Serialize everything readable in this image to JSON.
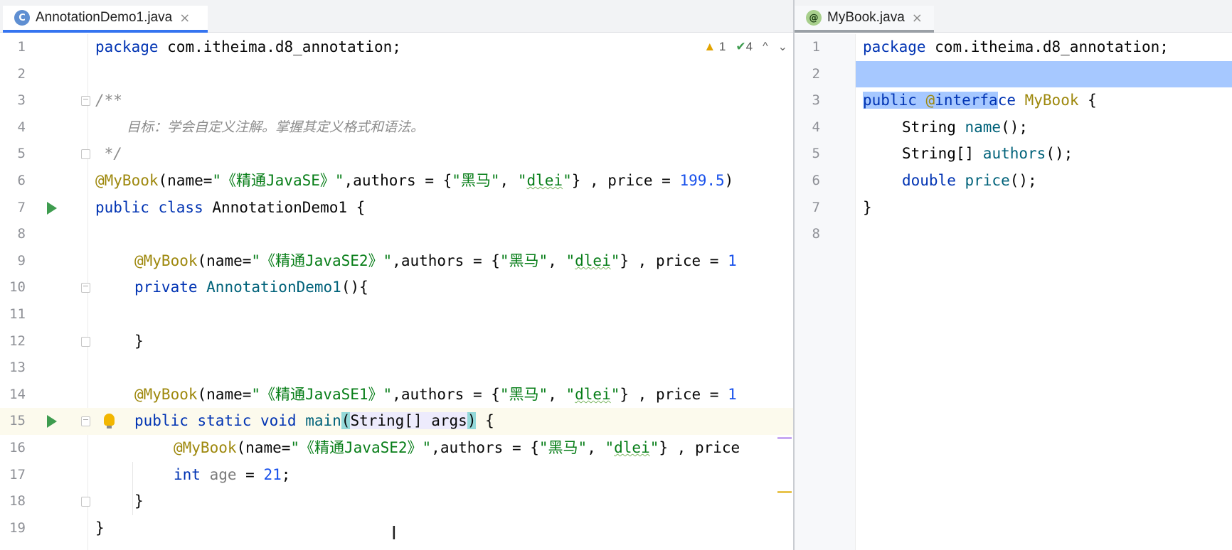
{
  "left_tab": {
    "icon": "class-file-icon",
    "label": "AnnotationDemo1.java",
    "close": "×"
  },
  "right_tab": {
    "icon": "annotation-file-icon",
    "label": "MyBook.java",
    "close": "×"
  },
  "inspections": {
    "warnings": "1",
    "checks": "4",
    "up": "^",
    "down": "⌄"
  },
  "left_lines": [
    "1",
    "2",
    "3",
    "4",
    "5",
    "6",
    "7",
    "8",
    "9",
    "10",
    "11",
    "12",
    "13",
    "14",
    "15",
    "16",
    "17",
    "18",
    "19"
  ],
  "right_lines": [
    "1",
    "2",
    "3",
    "4",
    "5",
    "6",
    "7",
    "8"
  ],
  "left_code": {
    "l1_kw": "package",
    "l1_rest": " com.itheima.d8_annotation;",
    "l3": "/**",
    "l4": "目标：学会自定义注解。掌握其定义格式和语法。",
    "l5": " */",
    "l6_ann": "@MyBook",
    "l6_a": "(name=",
    "l6_s1": "\"《精通JavaSE》\"",
    "l6_b": ",authors = {",
    "l6_s2": "\"黑马\"",
    "l6_c": ", ",
    "l6_s3a": "\"",
    "l6_s3b": "dlei",
    "l6_s3c": "\"",
    "l6_d": "} , price = ",
    "l6_num": "199.5",
    "l6_e": ")",
    "l7_kw": "public class",
    "l7_rest": " AnnotationDemo1 {",
    "l9_ann": "@MyBook",
    "l9_a": "(name=",
    "l9_s1": "\"《精通JavaSE2》\"",
    "l9_b": ",authors = {",
    "l9_s2": "\"黑马\"",
    "l9_c": ", ",
    "l9_s3a": "\"",
    "l9_s3b": "dlei",
    "l9_s3c": "\"",
    "l9_d": "} , price = ",
    "l9_num": "1",
    "l10_kw": "private",
    "l10_fn": " AnnotationDemo1",
    "l10_rest": "(){",
    "l12": "}",
    "l14_ann": "@MyBook",
    "l14_a": "(name=",
    "l14_s1": "\"《精通JavaSE1》\"",
    "l14_b": ",authors = {",
    "l14_s2": "\"黑马\"",
    "l14_c": ", ",
    "l14_s3a": "\"",
    "l14_s3b": "dlei",
    "l14_s3c": "\"",
    "l14_d": "} , price = ",
    "l14_num": "1",
    "l15_kw": "public static void",
    "l15_fn": " main",
    "l15_p1": "(",
    "l15_args": "String[] args",
    "l15_p2": ")",
    "l15_rest": " {",
    "l16_ann": "@MyBook",
    "l16_a": "(name=",
    "l16_s1": "\"《精通JavaSE2》\"",
    "l16_b": ",authors = {",
    "l16_s2": "\"黑马\"",
    "l16_c": ", ",
    "l16_s3a": "\"",
    "l16_s3b": "dlei",
    "l16_s3c": "\"",
    "l16_d": "} , price",
    "l17_kw": "int",
    "l17_var": " age",
    "l17_eq": " = ",
    "l17_num": "21",
    "l17_end": ";",
    "l18": "}",
    "l19": "}"
  },
  "right_code": {
    "l1_kw": "package",
    "l1_rest": " com.itheima.d8_annotation;",
    "l3_kw": "public",
    "l3_sp": " ",
    "l3_ann1": "@",
    "l3_kw2": "interfa",
    "l3_kw3": "ce",
    "l3_name": " MyBook",
    "l3_rest": " {",
    "l4_type": "String",
    "l4_fn": " name",
    "l4_rest": "();",
    "l5_type": "String[]",
    "l5_fn": " authors",
    "l5_rest": "();",
    "l6_kw": "double",
    "l6_fn": " price",
    "l6_rest": "();",
    "l7": "}"
  },
  "cursor": "I"
}
